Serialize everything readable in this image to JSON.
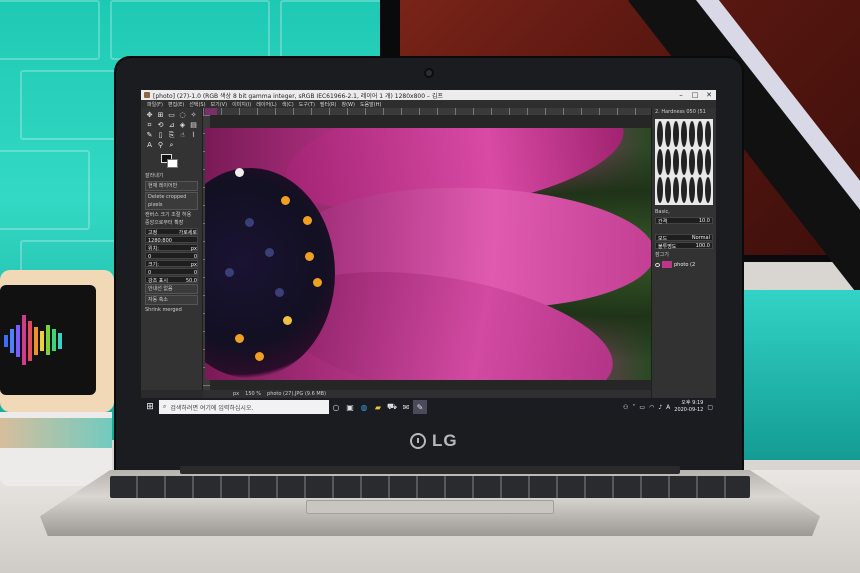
{
  "window": {
    "title": "[photo] (27)-1.0 (RGB 색상 8 bit gamma integer, sRGB IEC61966-2.1, 레이어 1 개) 1280x800 – 김프"
  },
  "menu": [
    "파일(F)",
    "편집(E)",
    "선택(S)",
    "보기(V)",
    "이미지(I)",
    "레이어(L)",
    "색(C)",
    "도구(T)",
    "필터(R)",
    "창(W)",
    "도움말(H)"
  ],
  "tool_options": {
    "items": [
      {
        "label": "잘라내기"
      },
      {
        "label": "현재 레이어만"
      },
      {
        "label": "Delete cropped pixels"
      },
      {
        "label": "캔버스 크기 조절 허용"
      },
      {
        "label": "중앙으로부터 확장"
      },
      {
        "label": "고정",
        "value": "가로세로"
      },
      {
        "label": "1280:800"
      },
      {
        "label": "위치:",
        "value": "px"
      },
      {
        "label": "0",
        "value": "0"
      },
      {
        "label": "크기:",
        "value": "px"
      },
      {
        "label": "0",
        "value": "0"
      },
      {
        "label": "강조 표시",
        "value": "50.0"
      },
      {
        "label": "안내선 없음"
      },
      {
        "label": "자동 축소"
      },
      {
        "label": "Shrink merged"
      }
    ]
  },
  "canvas": {
    "status": {
      "unit": "px",
      "zoom": "150 %",
      "file": "photo (27).JPG (9.6 MB)"
    }
  },
  "dock": {
    "brush_header": "2. Hardness 050 (51",
    "brush_set": "Basic,",
    "spacing_label": "간격",
    "spacing_value": "10.0",
    "mode_label": "모드",
    "mode_value": "Normal",
    "opacity_label": "불투명도",
    "opacity_value": "100.0",
    "lock_label": "잠그기",
    "layer_name": "photo (2"
  },
  "taskbar": {
    "search_placeholder": "검색하려면 여기에 입력하십시오.",
    "time": "오후 9:19",
    "date": "2020-09-12",
    "ime": "A"
  },
  "brand": {
    "laptop_logo": "LG"
  },
  "colors": {
    "gimp_bg": "#2a2a2a",
    "taskbar": "#1b1b22",
    "petal": "#c43a92",
    "stamen": "#f0a020"
  }
}
